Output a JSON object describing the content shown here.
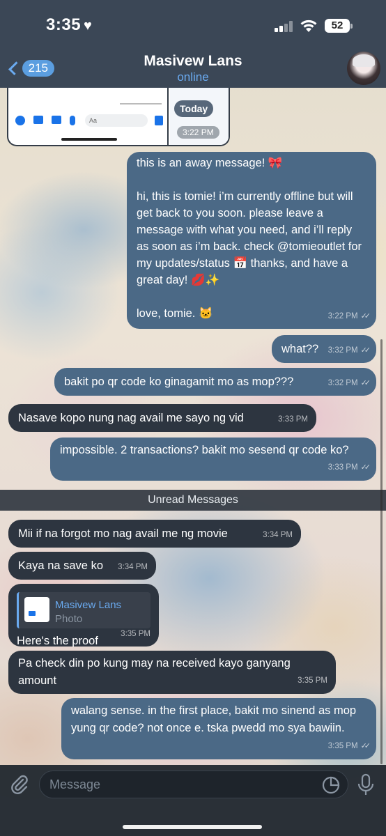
{
  "status_bar": {
    "time": "3:35",
    "heart": "♥",
    "battery": "52"
  },
  "header": {
    "back_count": "215",
    "title": "Masivew Lans",
    "status": "online"
  },
  "photo_preview": {
    "input_placeholder": "Aa",
    "date_pill": "Today",
    "time": "3:22 PM"
  },
  "messages": [
    {
      "direction": "out",
      "text": "this is an away message! 🎀\n\nhi, this is tomie! i’m currently offline but will get back to you soon. please leave a message with what you need, and i’ll reply as soon as i’m back. check @tomieoutlet for my updates/status 📅 thanks, and have a great day! 💋✨\n\nlove, tomie. 🐱",
      "time": "3:22 PM"
    },
    {
      "direction": "out",
      "text": "what??",
      "time": "3:32 PM"
    },
    {
      "direction": "out",
      "text": "bakit po qr code ko ginagamit mo as mop???",
      "time": "3:32 PM"
    },
    {
      "direction": "in",
      "text": "Nasave kopo nung nag avail me sayo ng vid",
      "time": "3:33 PM"
    },
    {
      "direction": "out",
      "text": "impossible. 2 transactions? bakit mo sesend qr code ko?",
      "time": "3:33 PM"
    },
    {
      "direction": "in",
      "text": "Mii if na forgot mo nag avail me ng movie",
      "time": "3:34 PM"
    },
    {
      "direction": "in",
      "text": "Kaya na save ko",
      "time": "3:34 PM"
    },
    {
      "direction": "in",
      "text": "Here's the proof",
      "time": "3:35 PM",
      "reply": {
        "name": "Masivew Lans",
        "type": "Photo"
      }
    },
    {
      "direction": "in",
      "text": "Pa check din po kung may na received kayo ganyang amount",
      "time": "3:35 PM"
    },
    {
      "direction": "out",
      "text": "walang sense. in the first place, bakit mo sinend as mop yung qr code? not once e. tska pwedd mo sya bawiin.",
      "time": "3:35 PM"
    }
  ],
  "unread_label": "Unread Messages",
  "composer": {
    "placeholder": "Message"
  },
  "colors": {
    "header_bg": "#303e4f",
    "outgoing_bubble": "#4b6986",
    "incoming_bubble": "#2d3540",
    "accent": "#6aaaf0"
  }
}
